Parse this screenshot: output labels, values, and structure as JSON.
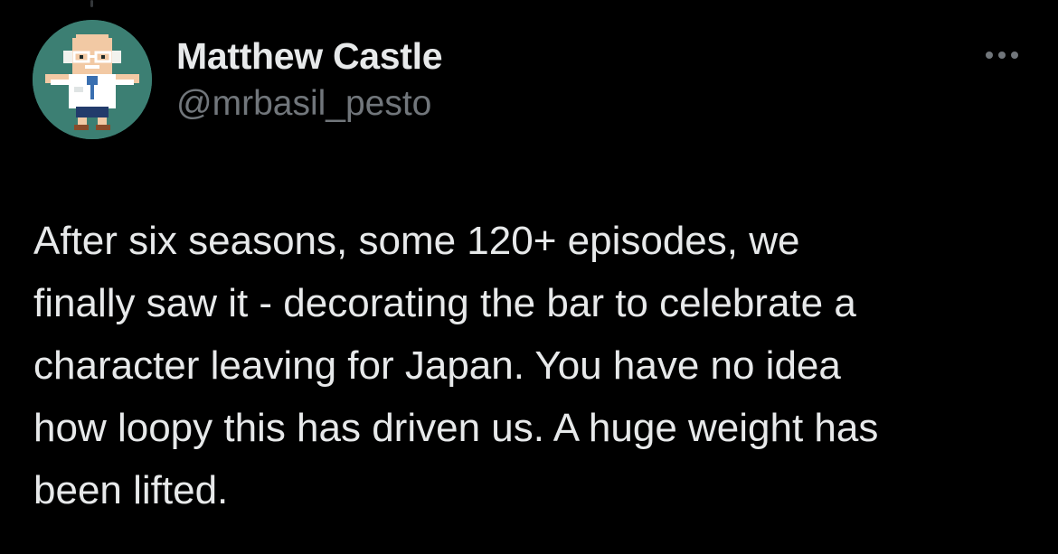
{
  "author": {
    "display_name": "Matthew Castle",
    "handle": "@mrbasil_pesto",
    "avatar_icon": "pixel-art-scientist-avatar",
    "avatar_bg_color": "#3c7f73"
  },
  "menu": {
    "icon": "more-dots-icon"
  },
  "tweet": {
    "lines": [
      "After six seasons, some 120+ episodes, we",
      "finally saw it - decorating the bar to celebrate a",
      "character leaving for Japan. You have no idea",
      "how loopy this has driven us. A huge weight has",
      "been lifted."
    ]
  },
  "colors": {
    "background": "#000000",
    "primary_text": "#e7e9ea",
    "secondary_text": "#71767b"
  }
}
